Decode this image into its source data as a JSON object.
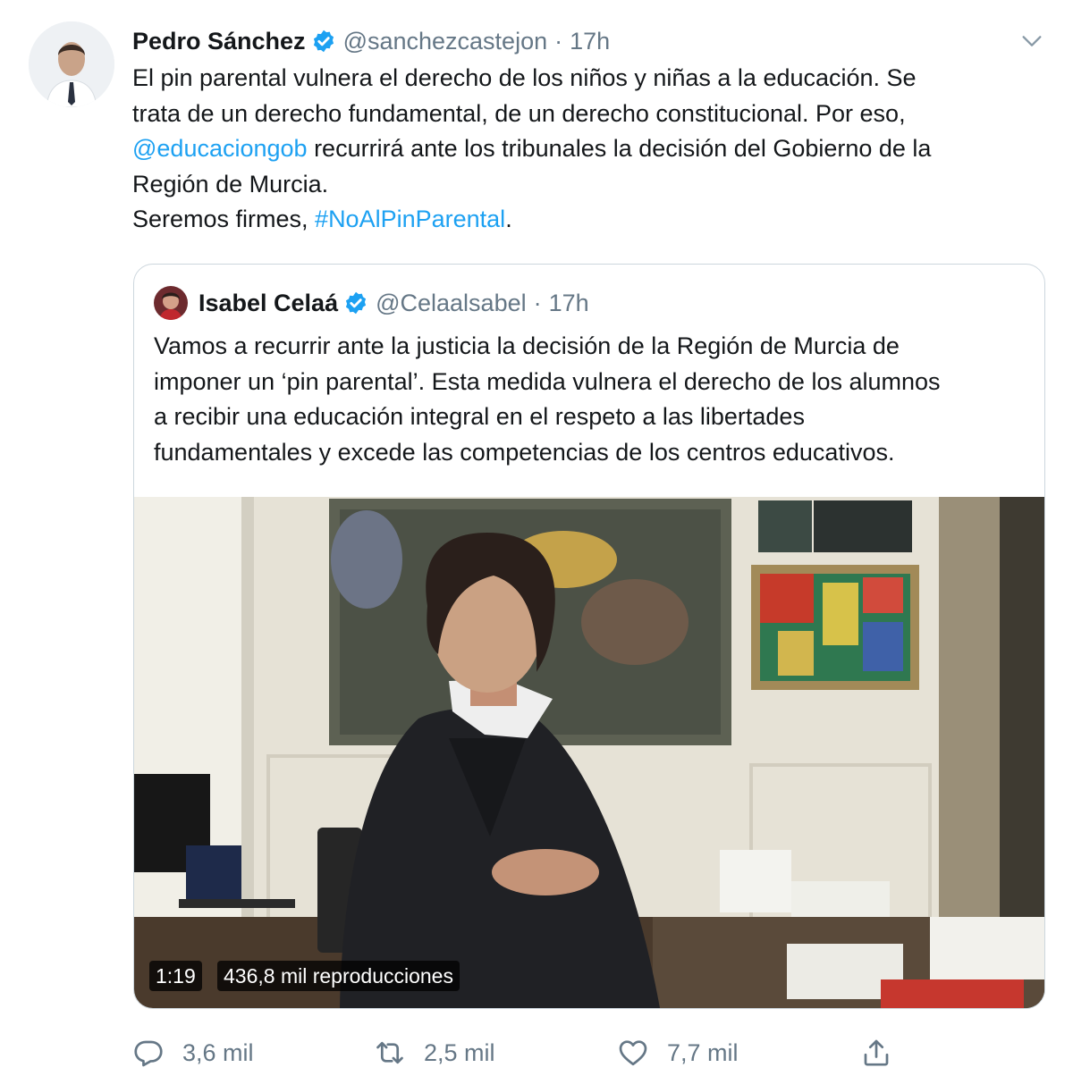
{
  "tweet": {
    "author_name": "Pedro Sánchez",
    "author_handle": "@sanchezcastejon",
    "separator": "·",
    "time": "17h",
    "text_lines": [
      "El pin parental vulnera el derecho de los niños y niñas a la educación. Se",
      "trata de un derecho fundamental, de un derecho constitucional. Por eso,"
    ],
    "mention": "@educaciongob",
    "line3_rest": " recurrirá ante los tribunales la decisión del Gobierno de la",
    "line4": "Región de Murcia.",
    "line5_prefix": "Seremos firmes, ",
    "hashtag": "#NoAlPinParental",
    "line5_suffix": "."
  },
  "quoted": {
    "author_name": "Isabel Celaá",
    "author_handle": "@Celaalsabel",
    "separator": "·",
    "time": "17h",
    "text_lines": [
      "Vamos a recurrir ante la justicia la decisión de la Región de Murcia de",
      "imponer un ‘pin parental’. Esta medida vulnera el derecho de los alumnos",
      "a recibir una educación integral en el respeto a las libertades",
      "fundamentales y excede las competencias de los centros educativos."
    ],
    "video": {
      "duration": "1:19",
      "views": "436,8 mil reproducciones"
    }
  },
  "actions": {
    "reply_count": "3,6 mil",
    "retweet_count": "2,5 mil",
    "like_count": "7,7 mil"
  },
  "colors": {
    "link": "#1da1f2",
    "secondary_text": "#657786",
    "verified": "#1da1f2",
    "border": "#ccd6dd"
  },
  "icons": [
    "verified-badge-icon",
    "chevron-down-icon",
    "reply-icon",
    "retweet-icon",
    "like-icon",
    "share-icon"
  ]
}
